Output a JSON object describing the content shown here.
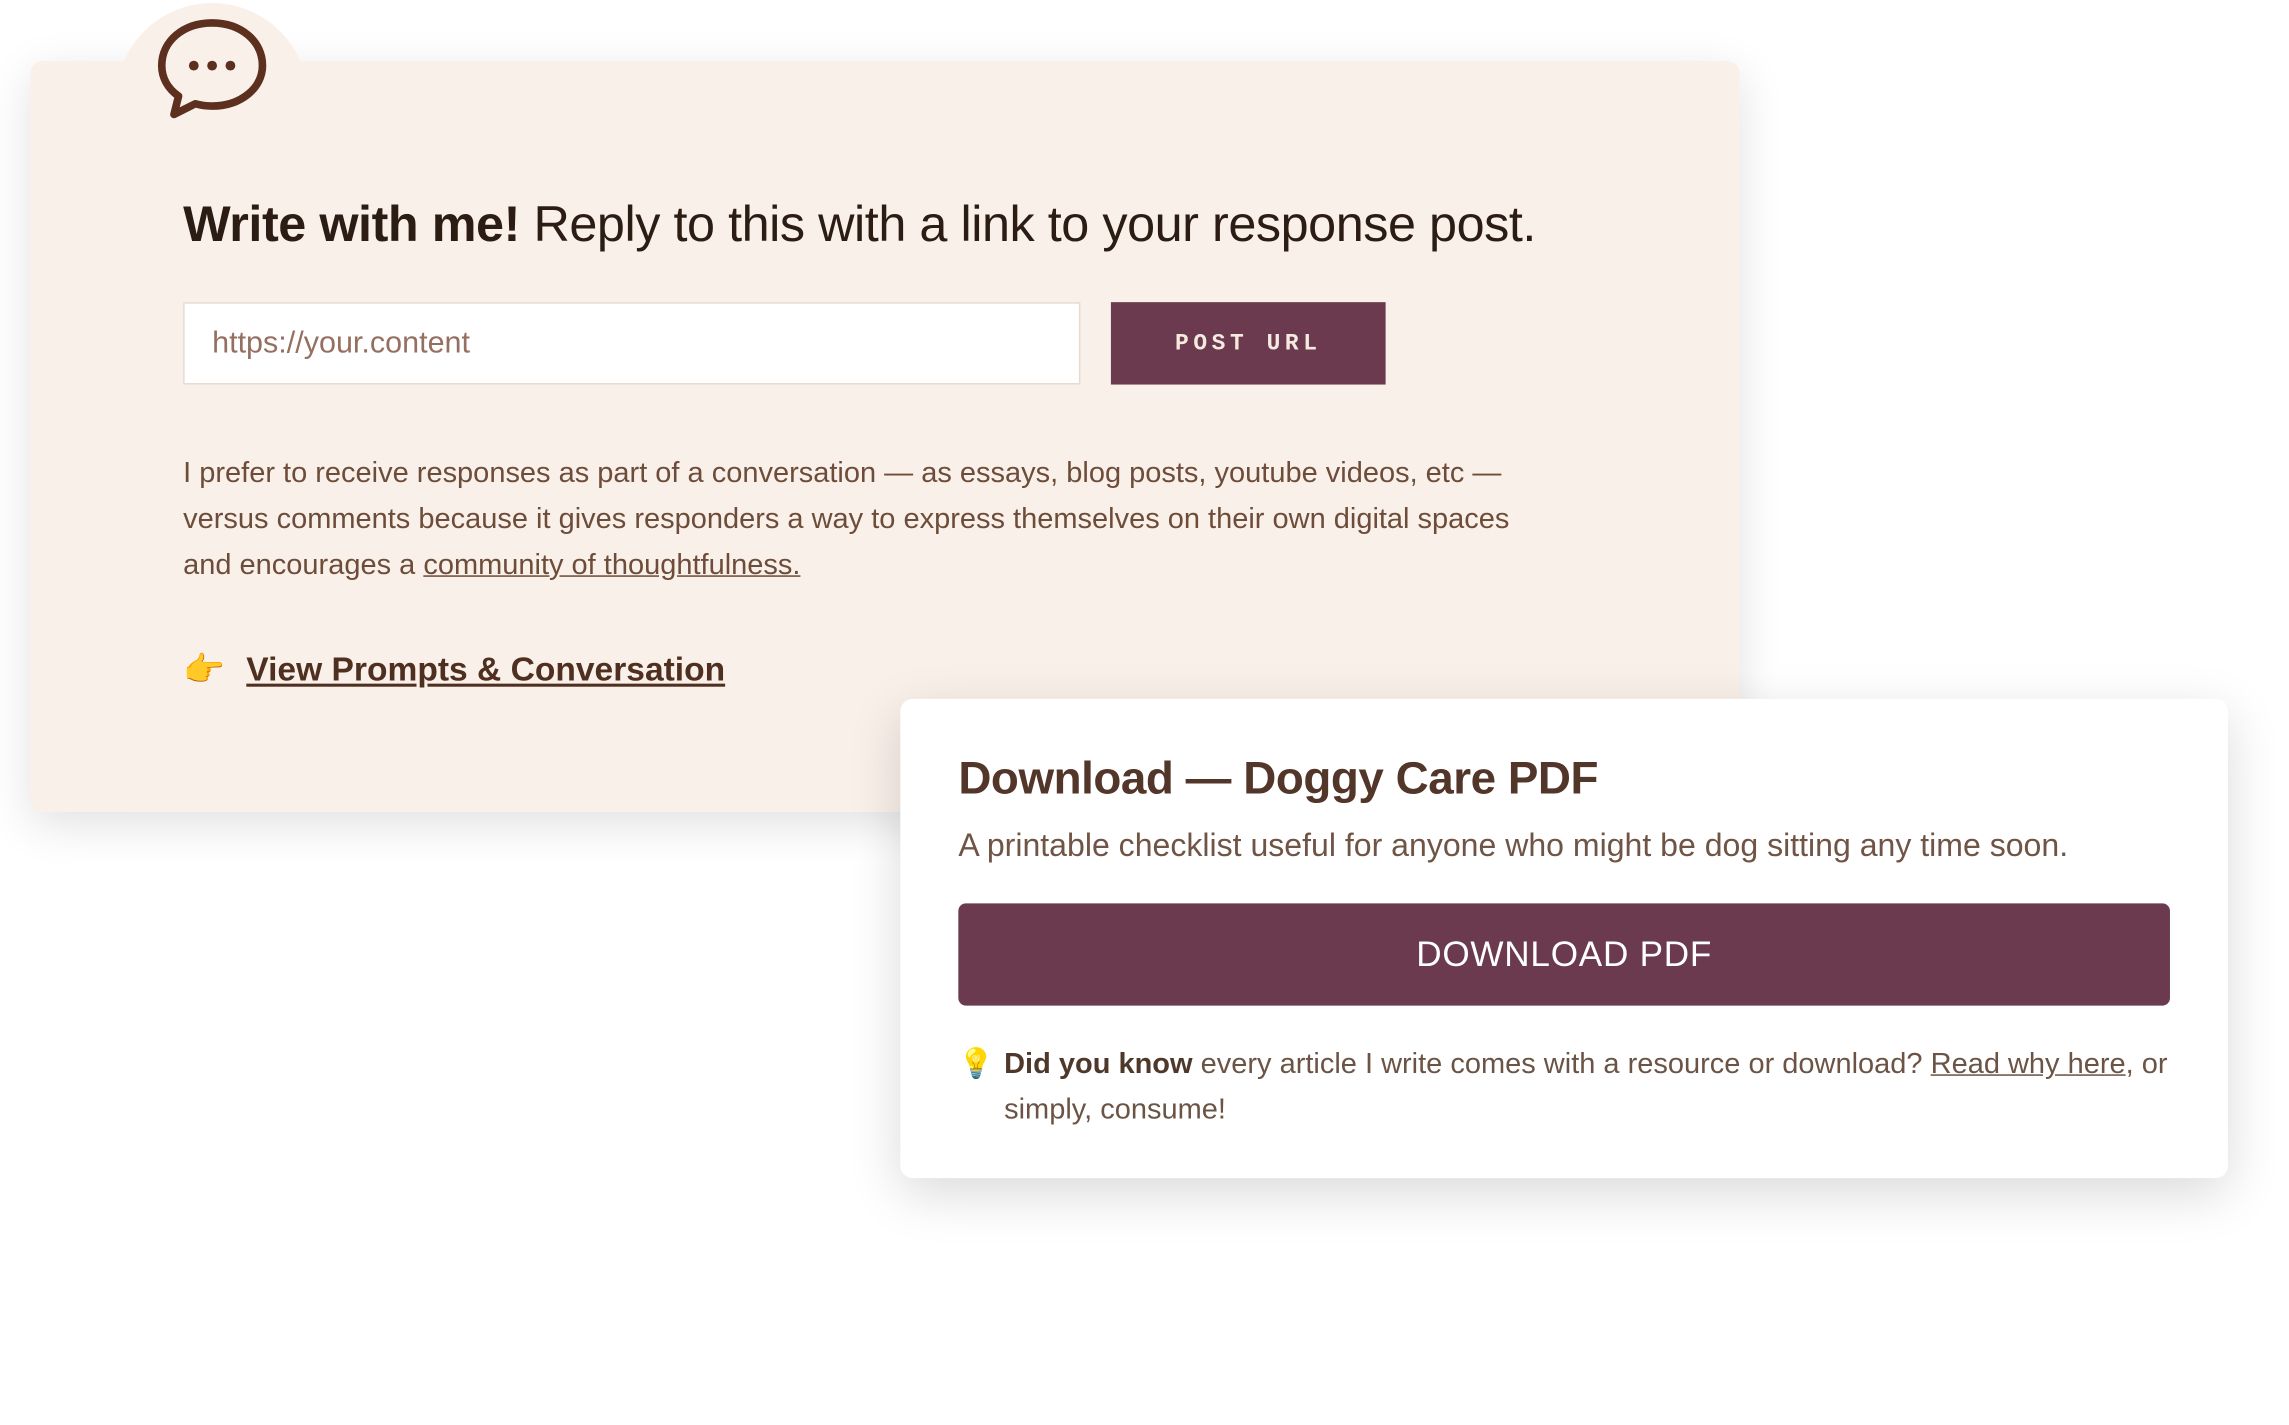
{
  "reply_card": {
    "heading_bold": "Write with me!",
    "heading_rest": " Reply to this with a link to your response post.",
    "url_placeholder": "https://your.content",
    "post_button": "POST URL",
    "desc_1": "I prefer to receive responses as part of a conversation —  as essays, blog posts, youtube videos, etc — versus comments because it gives responders a way to express themselves on their own digital spaces and encourages a ",
    "desc_link": "community of thoughtfulness.",
    "pointer_emoji": "👉",
    "prompts_link": "View Prompts & Conversation"
  },
  "download_card": {
    "title": "Download — Doggy Care PDF",
    "desc": "A printable checklist useful for anyone who might be dog sitting any time soon.",
    "button": "DOWNLOAD PDF",
    "bulb_emoji": "💡",
    "note_bold": "Did you know",
    "note_1": " every article I write comes with a resource or download? ",
    "note_link": "Read why here",
    "note_2": ", or simply, consume!"
  }
}
